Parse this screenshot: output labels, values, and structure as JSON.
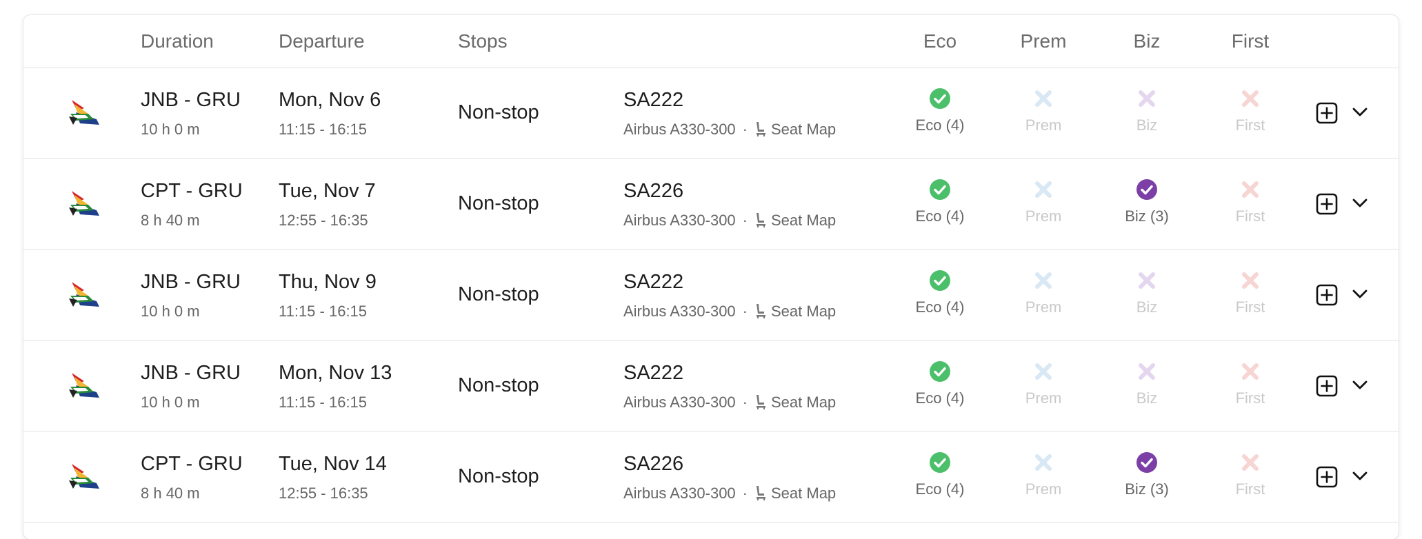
{
  "header": {
    "duration": "Duration",
    "departure": "Departure",
    "stops": "Stops",
    "eco": "Eco",
    "prem": "Prem",
    "biz": "Biz",
    "first": "First"
  },
  "colors": {
    "eco": "#4cbf6b",
    "prem": "#d8e8f4",
    "biz": "#7c3fa6",
    "biz_faded": "#e4d6ee",
    "first_faded": "#f6d5d3"
  },
  "icons": {
    "airline_logo": "south-african-airways-logo",
    "seat": "seat-icon",
    "available": "check-circle-icon",
    "unavailable": "x-icon",
    "add": "plus-square-icon",
    "expand": "chevron-down-icon"
  },
  "rows": [
    {
      "route": "JNB - GRU",
      "duration": "10 h 0 m",
      "date": "Mon, Nov 6",
      "time": "11:15 - 16:15",
      "stops": "Non-stop",
      "flight": "SA222",
      "aircraft": "Airbus A330-300",
      "separator": "·",
      "seatmap": "Seat Map",
      "eco": "Eco (4)",
      "prem": "Prem",
      "biz": "Biz",
      "first": "First",
      "eco_available": true,
      "prem_available": false,
      "biz_available": false,
      "first_available": false
    },
    {
      "route": "CPT - GRU",
      "duration": "8 h 40 m",
      "date": "Tue, Nov 7",
      "time": "12:55 - 16:35",
      "stops": "Non-stop",
      "flight": "SA226",
      "aircraft": "Airbus A330-300",
      "separator": "·",
      "seatmap": "Seat Map",
      "eco": "Eco (4)",
      "prem": "Prem",
      "biz": "Biz (3)",
      "first": "First",
      "eco_available": true,
      "prem_available": false,
      "biz_available": true,
      "first_available": false
    },
    {
      "route": "JNB - GRU",
      "duration": "10 h 0 m",
      "date": "Thu, Nov 9",
      "time": "11:15 - 16:15",
      "stops": "Non-stop",
      "flight": "SA222",
      "aircraft": "Airbus A330-300",
      "separator": "·",
      "seatmap": "Seat Map",
      "eco": "Eco (4)",
      "prem": "Prem",
      "biz": "Biz",
      "first": "First",
      "eco_available": true,
      "prem_available": false,
      "biz_available": false,
      "first_available": false
    },
    {
      "route": "JNB - GRU",
      "duration": "10 h 0 m",
      "date": "Mon, Nov 13",
      "time": "11:15 - 16:15",
      "stops": "Non-stop",
      "flight": "SA222",
      "aircraft": "Airbus A330-300",
      "separator": "·",
      "seatmap": "Seat Map",
      "eco": "Eco (4)",
      "prem": "Prem",
      "biz": "Biz",
      "first": "First",
      "eco_available": true,
      "prem_available": false,
      "biz_available": false,
      "first_available": false
    },
    {
      "route": "CPT - GRU",
      "duration": "8 h 40 m",
      "date": "Tue, Nov 14",
      "time": "12:55 - 16:35",
      "stops": "Non-stop",
      "flight": "SA226",
      "aircraft": "Airbus A330-300",
      "separator": "·",
      "seatmap": "Seat Map",
      "eco": "Eco (4)",
      "prem": "Prem",
      "biz": "Biz (3)",
      "first": "First",
      "eco_available": true,
      "prem_available": false,
      "biz_available": true,
      "first_available": false
    }
  ]
}
